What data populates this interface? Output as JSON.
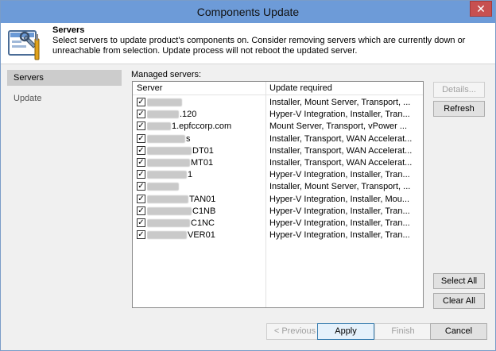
{
  "window": {
    "title": "Components Update",
    "close_glyph": "✕"
  },
  "header": {
    "title": "Servers",
    "description": "Select servers to update product's components on. Consider removing servers which are currently down or unreachable from selection. Update process will not reboot the updated server.",
    "icon": "tools-icon"
  },
  "sidebar": {
    "items": [
      {
        "label": "Servers",
        "active": true
      },
      {
        "label": "Update",
        "active": false
      }
    ]
  },
  "main": {
    "managed_label": "Managed servers:",
    "columns": [
      "Server",
      "Update required"
    ],
    "rows": [
      {
        "server": "",
        "update": "Installer, Mount Server, Transport, ...",
        "checked": true
      },
      {
        "server": ".120",
        "update": "Hyper-V Integration, Installer, Tran...",
        "checked": true
      },
      {
        "server": "1.epfccorp.com",
        "update": "Mount Server, Transport, vPower ...",
        "checked": true
      },
      {
        "server": "s",
        "update": "Installer, Transport, WAN Accelerat...",
        "checked": true
      },
      {
        "server": "DT01",
        "update": "Installer, Transport, WAN Accelerat...",
        "checked": true
      },
      {
        "server": "MT01",
        "update": "Installer, Transport, WAN Accelerat...",
        "checked": true
      },
      {
        "server": "1",
        "update": "Hyper-V Integration, Installer, Tran...",
        "checked": true
      },
      {
        "server": "",
        "update": "Installer, Mount Server, Transport, ...",
        "checked": true
      },
      {
        "server": "TAN01",
        "update": "Hyper-V Integration, Installer, Mou...",
        "checked": true
      },
      {
        "server": "C1NB",
        "update": "Hyper-V Integration, Installer, Tran...",
        "checked": true
      },
      {
        "server": "C1NC",
        "update": "Hyper-V Integration, Installer, Tran...",
        "checked": true
      },
      {
        "server": "VER01",
        "update": "Hyper-V Integration, Installer, Tran...",
        "checked": true
      }
    ],
    "check_glyph": "✓",
    "details_label": "Details...",
    "refresh_label": "Refresh",
    "select_all_label": "Select All",
    "clear_all_label": "Clear All"
  },
  "footer": {
    "previous_label": "< Previous",
    "apply_label": "Apply",
    "finish_label": "Finish",
    "cancel_label": "Cancel"
  },
  "colors": {
    "titlebar": "#6d9bd8",
    "close": "#c75050",
    "selected_side": "#cccccc"
  }
}
